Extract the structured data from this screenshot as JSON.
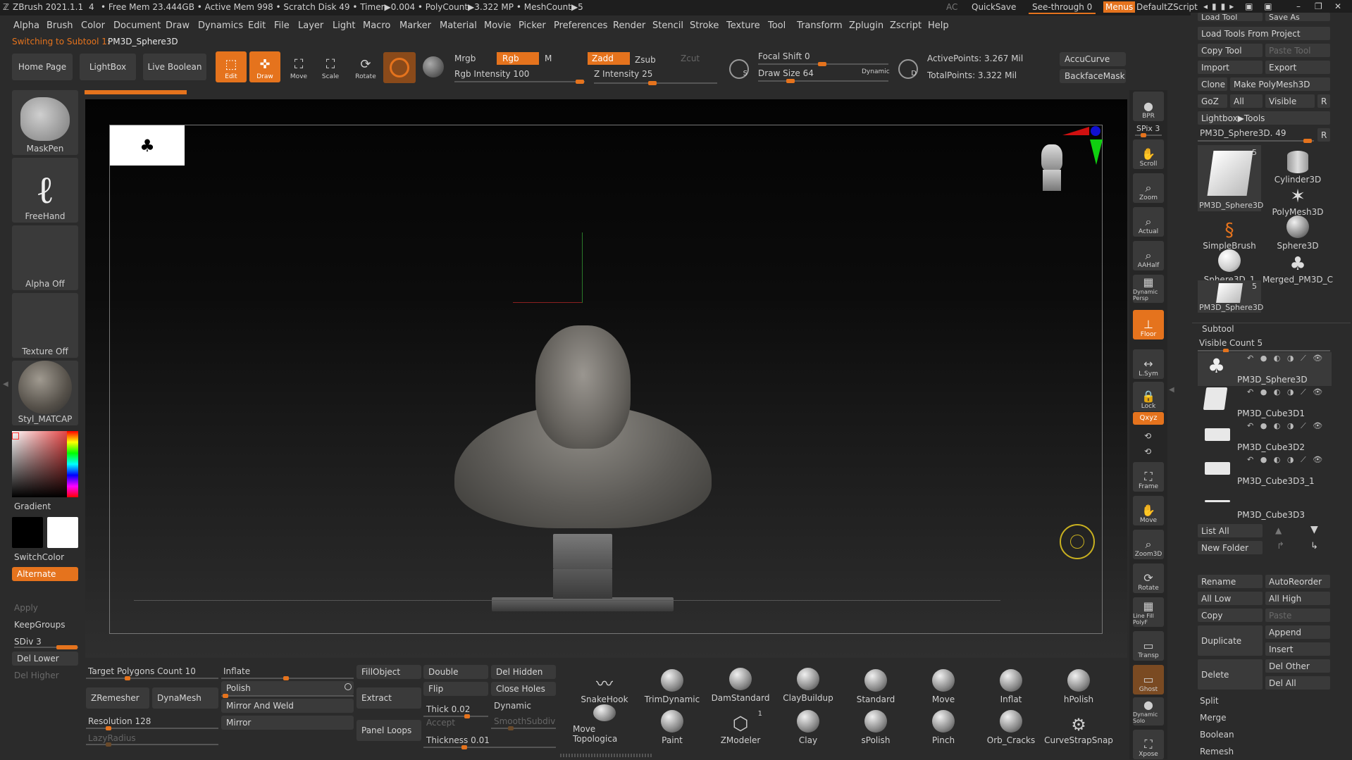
{
  "titlebar": {
    "app": "ZBrush 2021.1.1",
    "num": "4",
    "stats": "• Free Mem 23.444GB • Active Mem 998 • Scratch Disk 49 • Timer▶0.004 • PolyCount▶3.322 MP • MeshCount▶5",
    "ac": "AC",
    "quicksave": "QuickSave",
    "see_through": "See-through 0",
    "menus": "Menus",
    "zscript": "DefaultZScript"
  },
  "menus": [
    "Alpha",
    "Brush",
    "Color",
    "Document",
    "Draw",
    "Dynamics",
    "Edit",
    "File",
    "Layer",
    "Light",
    "Macro",
    "Marker",
    "Material",
    "Movie",
    "Picker",
    "Preferences",
    "Render",
    "Stencil",
    "Stroke",
    "Texture",
    "Tool",
    "Transform",
    "Zplugin",
    "Zscript",
    "Help"
  ],
  "status": {
    "label": "Switching to Subtool 1:",
    "value": "PM3D_Sphere3D"
  },
  "top_tabs": [
    "Home Page",
    "LightBox",
    "Live Boolean"
  ],
  "transform_tools": [
    "Edit",
    "Draw",
    "Move",
    "Scale",
    "Rotate"
  ],
  "color_modes": {
    "mrgb": "Mrgb",
    "rgb": "Rgb",
    "m": "M",
    "rgb_intensity": "Rgb Intensity 100"
  },
  "z_modes": {
    "zadd": "Zadd",
    "zsub": "Zsub",
    "zcut": "Zcut",
    "z_intensity": "Z Intensity 25"
  },
  "focal": {
    "focal_shift": "Focal Shift 0",
    "draw_size": "Draw Size 64",
    "dynamic": "Dynamic"
  },
  "points": {
    "active": "ActivePoints: 3.267 Mil",
    "total": "TotalPoints: 3.322 Mil"
  },
  "curve": {
    "accucurve": "AccuCurve",
    "backface": "BackfaceMask"
  },
  "left_shelf": {
    "brush": "MaskPen",
    "stroke": "FreeHand",
    "alpha": "Alpha Off",
    "texture": "Texture Off",
    "material": "Styl_MATCAP",
    "gradient": "Gradient",
    "switch_color": "SwitchColor",
    "alternate": "Alternate",
    "apply": "Apply",
    "keep_groups": "KeepGroups",
    "sdiv": "SDiv 3",
    "del_lower": "Del Lower",
    "del_higher": "Del Higher"
  },
  "right_rail": [
    "BPR",
    "SPix 3",
    "Scroll",
    "Zoom",
    "Actual",
    "AAHalf",
    "Dynamic Persp",
    "Floor",
    "L.Sym",
    "Lock",
    "Qxyz",
    "Frame",
    "Move",
    "Zoom3D",
    "Rotate",
    "Line Fill PolyF",
    "Transp",
    "Ghost",
    "Dynamic Solo",
    "Xpose"
  ],
  "tool_panel": {
    "load_tool": "Load Tool",
    "save_as": "Save As",
    "load_from_project": "Load Tools From Project",
    "copy_tool": "Copy Tool",
    "paste_tool": "Paste Tool",
    "import": "Import",
    "export": "Export",
    "clone": "Clone",
    "make_polymesh": "Make PolyMesh3D",
    "goz": "GoZ",
    "all": "All",
    "visible": "Visible",
    "r": "R",
    "lightbox_tools": "Lightbox▶Tools",
    "current": "PM3D_Sphere3D. 49",
    "current_r": "R",
    "tools": [
      {
        "name": "PM3D_Sphere3D",
        "badge": "5"
      },
      {
        "name": "Cylinder3D",
        "badge": ""
      },
      {
        "name": "PM3D_Sphere3D",
        "badge": ""
      },
      {
        "name": "PolyMesh3D",
        "badge": ""
      },
      {
        "name": "SimpleBrush",
        "badge": ""
      },
      {
        "name": "Sphere3D",
        "badge": ""
      },
      {
        "name": "Sphere3D_1",
        "badge": ""
      },
      {
        "name": "Merged_PM3D_C",
        "badge": ""
      },
      {
        "name": "PM3D_Sphere3D",
        "badge": "5"
      }
    ]
  },
  "subtool": {
    "title": "Subtool",
    "visible_count": "Visible Count 5",
    "items": [
      "PM3D_Sphere3D",
      "PM3D_Cube3D1",
      "PM3D_Cube3D2",
      "PM3D_Cube3D3_1",
      "PM3D_Cube3D3"
    ],
    "list_all": "List All",
    "new_folder": "New Folder",
    "rename": "Rename",
    "autoreorder": "AutoReorder",
    "all_low": "All Low",
    "all_high": "All High",
    "copy": "Copy",
    "paste": "Paste",
    "duplicate": "Duplicate",
    "append": "Append",
    "insert": "Insert",
    "delete": "Delete",
    "del_other": "Del Other",
    "del_all": "Del All",
    "split": "Split",
    "merge": "Merge",
    "boolean": "Boolean",
    "remesh": "Remesh"
  },
  "bottom": {
    "target_polys": "Target Polygons Count 10",
    "zremesher": "ZRemesher",
    "dynamesh": "DynaMesh",
    "resolution": "Resolution 128",
    "lazy_radius": "LazyRadius",
    "inflate": "Inflate",
    "polish": "Polish",
    "mirror_weld": "Mirror And Weld",
    "mirror": "Mirror",
    "fill_object": "FillObject",
    "extract": "Extract",
    "panel_loops": "Panel Loops",
    "double": "Double",
    "flip": "Flip",
    "thick": "Thick 0.02",
    "accept": "Accept",
    "thickness": "Thickness 0.01",
    "del_hidden": "Del Hidden",
    "close_holes": "Close Holes",
    "dynamic": "Dynamic",
    "smooth_subdiv": "SmoothSubdiv",
    "brushes_row1": [
      "SnakeHook",
      "TrimDynamic",
      "DamStandard",
      "ClayBuildup",
      "Standard",
      "Move",
      "Inflat",
      "hPolish"
    ],
    "brushes_row2": [
      "Move Topologica",
      "Paint",
      "ZModeler",
      "Clay",
      "sPolish",
      "Pinch",
      "Orb_Cracks",
      "CurveStrapSnap"
    ],
    "zmodeler_badge": "1"
  }
}
